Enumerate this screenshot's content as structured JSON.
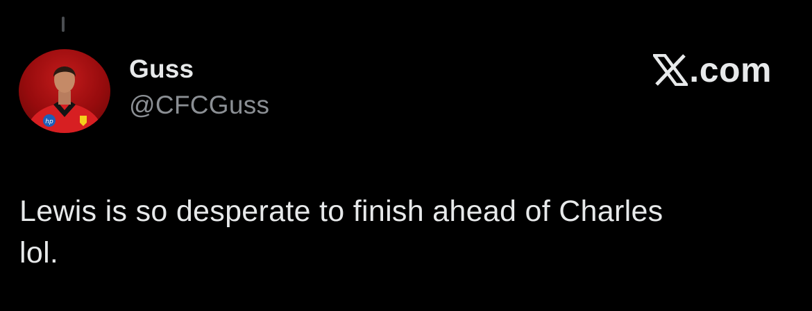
{
  "tweet": {
    "display_name": "Guss",
    "handle": "@CFCGuss",
    "text": "Lewis is so desperate to finish ahead of Charles\nlol.",
    "avatar_icon": "avatar-photo-icon"
  },
  "brand": {
    "label": ".com",
    "logo_icon": "x-logo-icon"
  },
  "colors": {
    "background": "#000000",
    "primary_text": "#e7e9ea",
    "secondary_text": "#8b8f94",
    "avatar_red": "#c4161c"
  }
}
